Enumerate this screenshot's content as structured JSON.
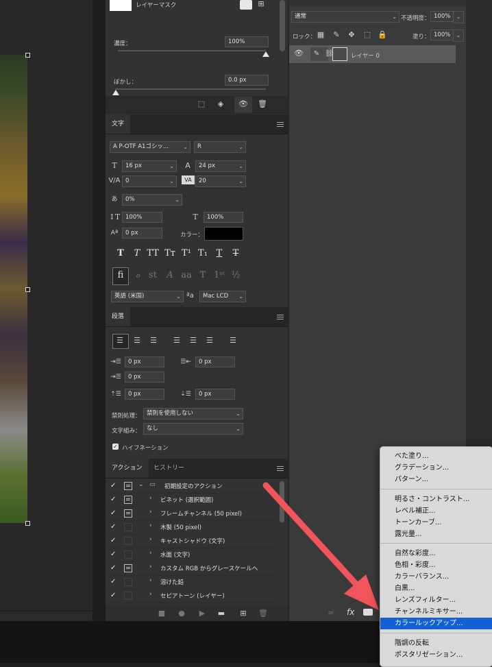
{
  "mask_panel": {
    "mask_label": "レイヤーマスク",
    "density_label": "濃度：",
    "density_value": "100%",
    "feather_label": "ぼかし：",
    "feather_value": "0.0 px"
  },
  "character_panel": {
    "tab_label": "文字",
    "font_family": "A P-OTF A1ゴシッ...",
    "font_style": "R",
    "font_size": "16 px",
    "leading": "24 px",
    "kerning": "0",
    "tracking": "20",
    "tsume": "0%",
    "vertical_scale": "100%",
    "horizontal_scale": "100%",
    "baseline_shift": "0 px",
    "color_label": "カラー：",
    "color_value": "#000000",
    "language": "英語 (米国)",
    "aa_label": "ªa",
    "antialias": "Mac LCD"
  },
  "paragraph_panel": {
    "tab_label": "段落",
    "indent_left": "0 px",
    "indent_right": "0 px",
    "indent_first": "0 px",
    "space_before": "0 px",
    "space_after": "0 px",
    "kinsoku_label": "禁則処理：",
    "kinsoku_value": "禁則を使用しない",
    "mojikumi_label": "文字組み：",
    "mojikumi_value": "なし",
    "hyphenation_label": "ハイフネーション"
  },
  "actions_panel": {
    "tabs": [
      "アクション",
      "ヒストリー"
    ],
    "rows": [
      {
        "label": "初期設定のアクション",
        "dialog": true,
        "folder": true
      },
      {
        "label": "ビネット (選択範囲)",
        "dialog": true
      },
      {
        "label": "フレームチャンネル (50 pixel)",
        "dialog": true
      },
      {
        "label": "木製 (50 pixel)",
        "dialog": false
      },
      {
        "label": "キャストシャドウ (文字)",
        "dialog": false
      },
      {
        "label": "水面 (文字)",
        "dialog": false
      },
      {
        "label": "カスタム RGB からグレースケールへ",
        "dialog": true
      },
      {
        "label": "溶けた鉛",
        "dialog": false
      },
      {
        "label": "セピアトーン (レイヤー)",
        "dialog": false
      }
    ]
  },
  "layers_panel": {
    "blend_mode": "通常",
    "opacity_label": "不透明度：",
    "opacity_value": "100%",
    "lock_label": "ロック：",
    "fill_label": "塗り：",
    "fill_value": "100%",
    "layer_name": "レイヤー 0",
    "fx_label": "fx"
  },
  "adjustment_menu": {
    "group1": [
      "べた塗り...",
      "グラデーション...",
      "パターン..."
    ],
    "group2": [
      "明るさ・コントラスト...",
      "レベル補正...",
      "トーンカーブ...",
      "露光量..."
    ],
    "group3": [
      "自然な彩度...",
      "色相・彩度...",
      "カラーバランス...",
      "白黒...",
      "レンズフィルター...",
      "チャンネルミキサー...",
      "カラールックアップ..."
    ],
    "group4": [
      "階調の反転",
      "ポスタリゼーション..."
    ],
    "selected": "カラールックアップ..."
  },
  "colors": {
    "selection": "#1360d4",
    "annotation_arrow": "#f2545b"
  }
}
